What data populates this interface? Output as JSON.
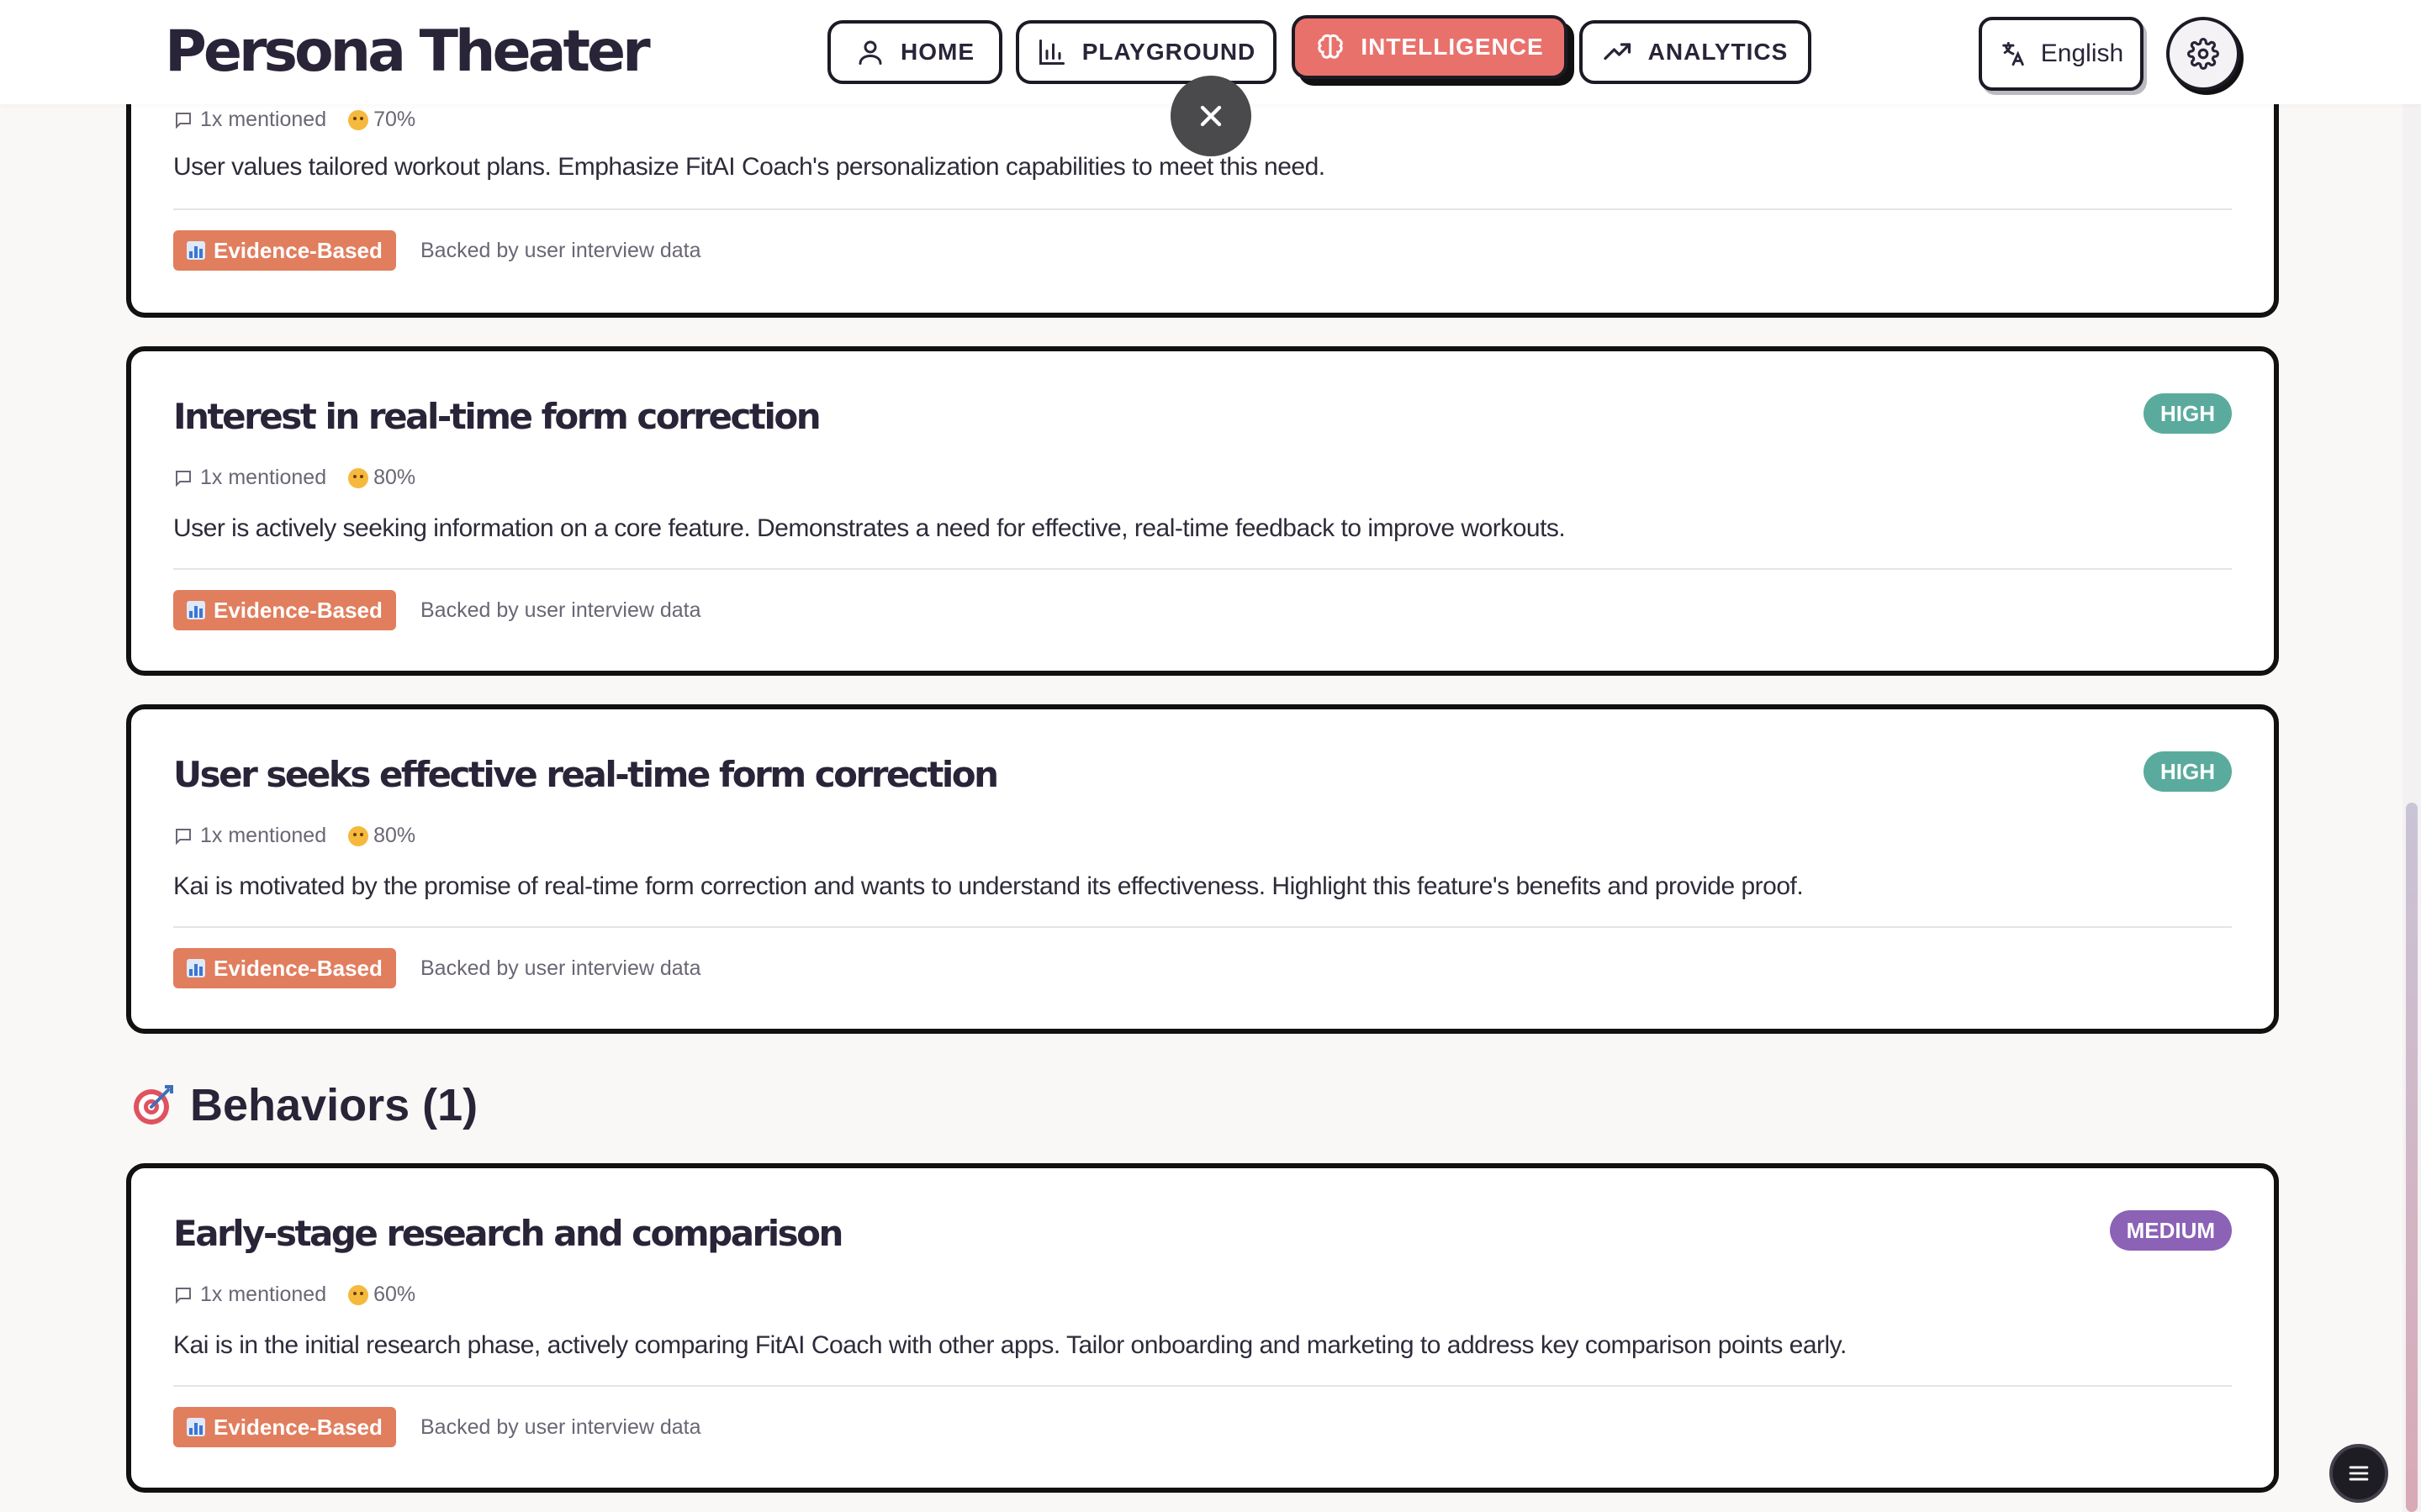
{
  "app": {
    "title": "Persona Theater"
  },
  "nav": {
    "home": "HOME",
    "playground": "PLAYGROUND",
    "intelligence": "INTELLIGENCE",
    "analytics": "ANALYTICS"
  },
  "language": {
    "label": "English"
  },
  "top_card": {
    "mentions": "1x mentioned",
    "score": "70%",
    "description": "User values tailored workout plans. Emphasize FitAI Coach's personalization capabilities to meet this need.",
    "evidence_label": "Evidence-Based",
    "evidence_note": "Backed by user interview data"
  },
  "cards": [
    {
      "title": "Interest in real-time form correction",
      "priority": "HIGH",
      "mentions": "1x mentioned",
      "score": "80%",
      "description": "User is actively seeking information on a core feature. Demonstrates a need for effective, real-time feedback to improve workouts.",
      "evidence_label": "Evidence-Based",
      "evidence_note": "Backed by user interview data"
    },
    {
      "title": "User seeks effective real-time form correction",
      "priority": "HIGH",
      "mentions": "1x mentioned",
      "score": "80%",
      "description": "Kai is motivated by the promise of real-time form correction and wants to understand its effectiveness. Highlight this feature's benefits and provide proof.",
      "evidence_label": "Evidence-Based",
      "evidence_note": "Backed by user interview data"
    }
  ],
  "behaviors": {
    "heading": "Behaviors (1)",
    "cards": [
      {
        "title": "Early-stage research and comparison",
        "priority": "MEDIUM",
        "mentions": "1x mentioned",
        "score": "60%",
        "description": "Kai is in the initial research phase, actively comparing FitAI Coach with other apps. Tailor onboarding and marketing to address key comparison points early.",
        "evidence_label": "Evidence-Based",
        "evidence_note": "Backed by user interview data"
      }
    ]
  },
  "colors": {
    "accent": "#e9716c",
    "high": "#5aab9d",
    "medium": "#8b62b6",
    "evidence": "#e17e5e"
  }
}
